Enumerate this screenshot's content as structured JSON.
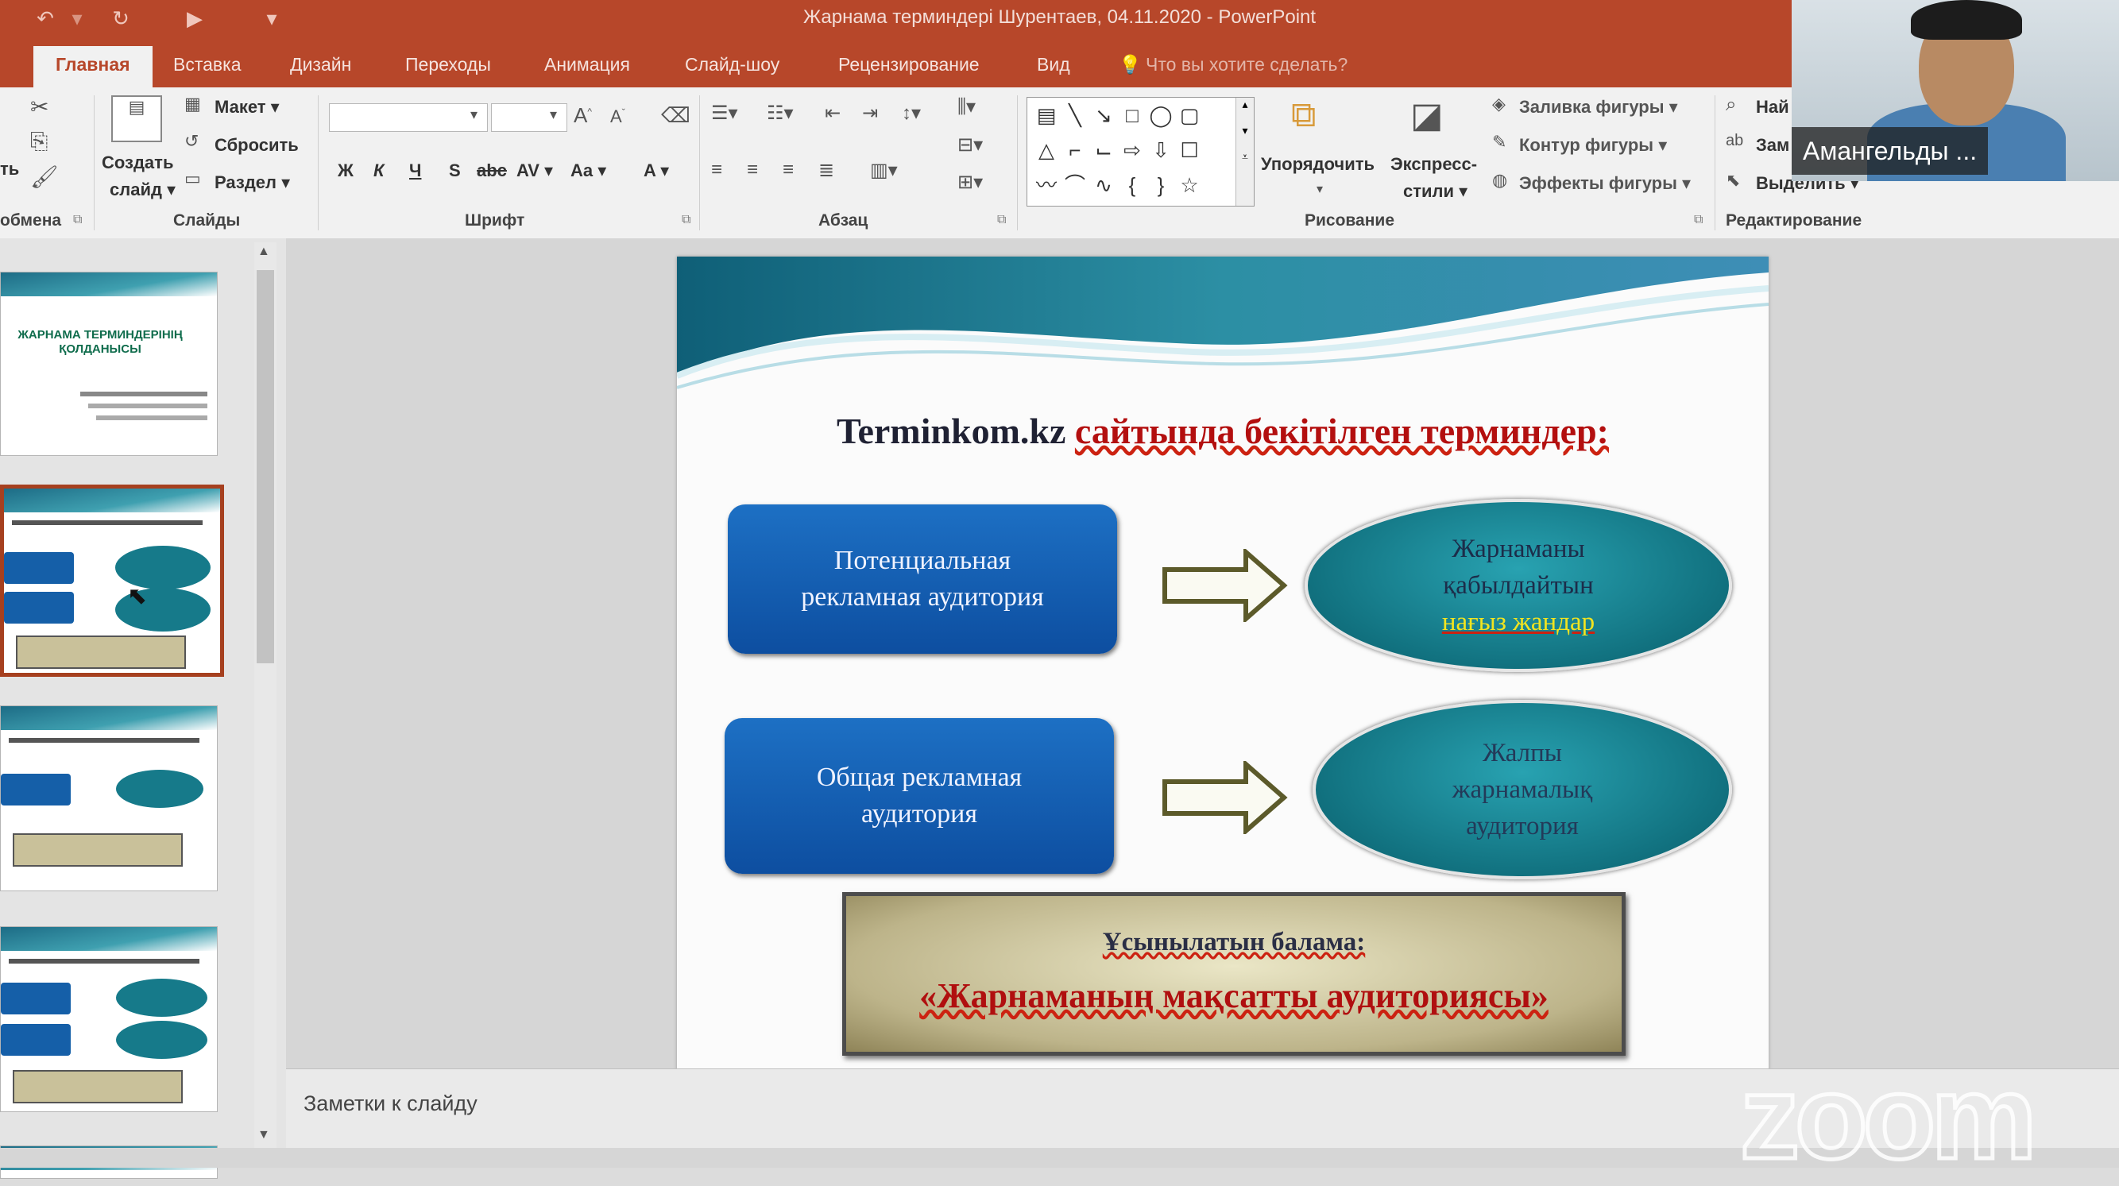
{
  "window": {
    "title": "Жарнама терминдері Шурентаев, 04.11.2020 - PowerPoint"
  },
  "quick_access": {
    "undo_icon": "undo-icon",
    "redo_icon": "redo-icon",
    "start_icon": "slideshow-start-icon",
    "customize_icon": "customize-icon"
  },
  "tabs": [
    "Главная",
    "Вставка",
    "Дизайн",
    "Переходы",
    "Анимация",
    "Слайд-шоу",
    "Рецензирование",
    "Вид"
  ],
  "tell_me": "Что вы хотите сделать?",
  "ribbon": {
    "groups": {
      "clipboard": "обмена",
      "slides": "Слайды",
      "font": "Шрифт",
      "paragraph": "Абзац",
      "drawing": "Рисование",
      "editing": "Редактирование"
    },
    "clipboard": {
      "paste_fragment": "ть"
    },
    "slides": {
      "new_slide_1": "Создать",
      "new_slide_2": "слайд ▾",
      "layout": "Макет ▾",
      "reset": "Сбросить",
      "section": "Раздел ▾"
    },
    "font": {
      "bold": "Ж",
      "italic": "К",
      "underline": "Ч",
      "shadow": "S",
      "strike": "abc",
      "spacing": "AV ▾",
      "case": "Aa ▾",
      "color": "A ▾"
    },
    "drawing": {
      "arrange": "Упорядочить",
      "styles_1": "Экспресс-",
      "styles_2": "стили ▾",
      "fill": "Заливка фигуры ▾",
      "outline": "Контур фигуры ▾",
      "effects": "Эффекты фигуры ▾"
    },
    "editing": {
      "find": "Най",
      "replace": "Зам",
      "select": "Выделить ▾"
    }
  },
  "slide": {
    "title_part1": "Terminkom.kz ",
    "title_part2": "сайтында бекітілген терминдер:",
    "box1_line1": "Потенциальная",
    "box1_line2": "рекламная аудитория",
    "ellipse1_line1": "Жарнаманы",
    "ellipse1_line2": "қабылдайтын",
    "ellipse1_line3": "нағыз жандар",
    "box2_line1": "Общая рекламная",
    "box2_line2": "аудитория",
    "ellipse2_line1": "Жалпы",
    "ellipse2_line2": "жарнамалық",
    "ellipse2_line3": "аудитория",
    "note_label": "Ұсынылатын балама:",
    "note_term": "«Жарнаманың мақсатты аудиториясы»"
  },
  "thumbnails": {
    "slide1_title": "ЖАРНАМА ТЕРМИНДЕРІНІҢ ҚОЛДАНЫСЫ",
    "selected_index": 2
  },
  "notes": {
    "placeholder": "Заметки к слайду"
  },
  "zoom": {
    "participant_name": "Амангельды ...",
    "logo": "zoom"
  },
  "colors": {
    "accent": "#b7472a",
    "box_blue": "#1563b5",
    "ellipse_teal": "#14808f",
    "title_red": "#b30f0f"
  }
}
